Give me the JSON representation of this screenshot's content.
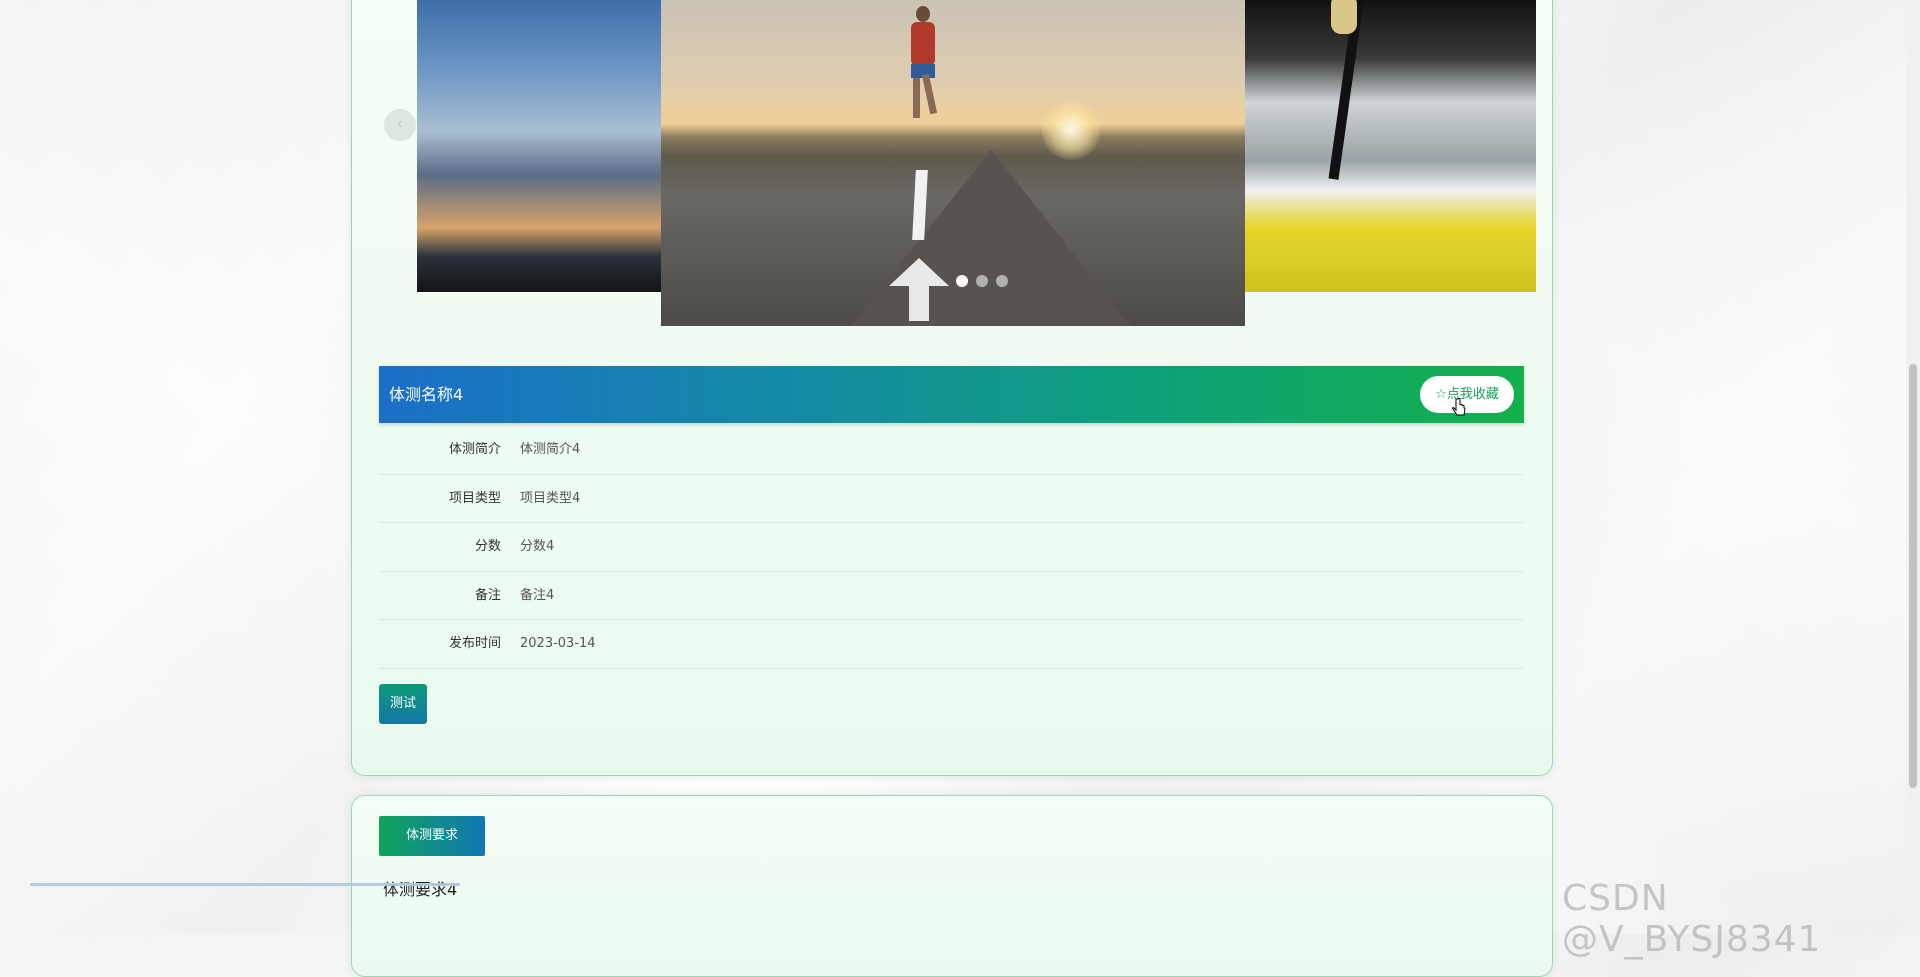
{
  "carousel": {
    "prev_label": "‹",
    "slides": [
      "sunset-sky",
      "runner-road",
      "kayak-rapids"
    ],
    "active_index": 0,
    "dot_count": 3
  },
  "detail": {
    "title": "体测名称4",
    "favorite_label": "☆点我收藏",
    "fields": [
      {
        "label": "体测简介",
        "value": "体测简介4"
      },
      {
        "label": "项目类型",
        "value": "项目类型4"
      },
      {
        "label": "分数",
        "value": "分数4"
      },
      {
        "label": "备注",
        "value": "备注4"
      },
      {
        "label": "发布时间",
        "value": "2023-03-14"
      }
    ],
    "test_button_label": "测试"
  },
  "requirements": {
    "tab_label": "体测要求",
    "content": "体测要求4"
  },
  "watermark": "CSDN @V_BYSJ8341",
  "colors": {
    "header_start": "#1c6fc9",
    "header_end": "#14b04c",
    "accent_green": "#15a35a",
    "panel_border": "#9fd6b0"
  }
}
